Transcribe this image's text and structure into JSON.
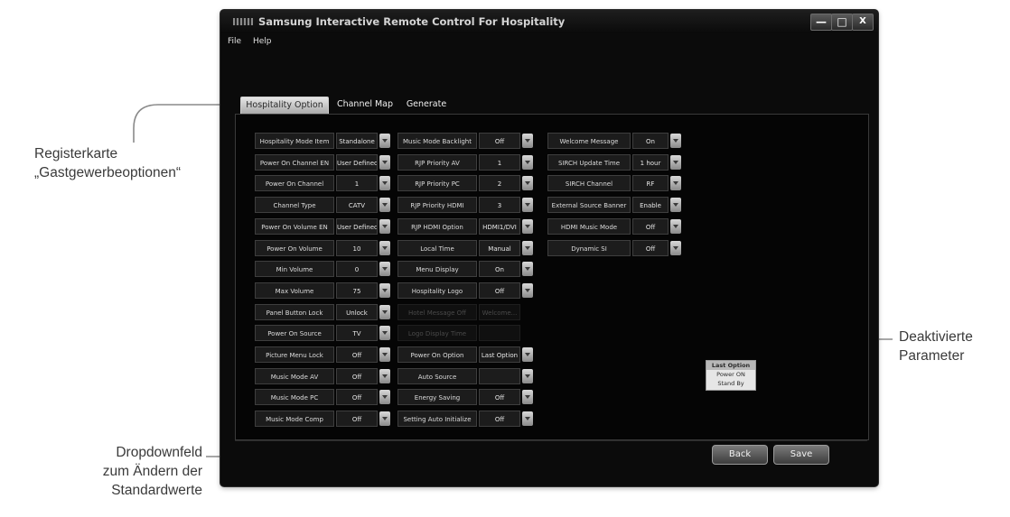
{
  "annotations": {
    "tab_callout": [
      "Registerkarte",
      "„Gastgewerbeoptionen“"
    ],
    "disabled_callout": [
      "Deaktivierte",
      "Parameter"
    ],
    "dropdown_callout": [
      "Dropdownfeld",
      "zum Ändern der",
      "Standardwerte"
    ]
  },
  "window": {
    "title": "Samsung Interactive Remote Control For Hospitality",
    "controls": {
      "minimize": "—",
      "maximize": "□",
      "close": "X"
    }
  },
  "menu": {
    "file": "File",
    "help": "Help"
  },
  "tabs": [
    {
      "label": "Hospitality Option",
      "active": true
    },
    {
      "label": "Channel Map",
      "active": false
    },
    {
      "label": "Generate",
      "active": false
    }
  ],
  "columns": [
    {
      "settings": [
        {
          "label": "Hospitality Mode Item",
          "value": "Standalone"
        },
        {
          "label": "Power On Channel EN",
          "value": "User Defined"
        },
        {
          "label": "Power On Channel",
          "value": "1"
        },
        {
          "label": "Channel Type",
          "value": "CATV"
        },
        {
          "label": "Power On Volume EN",
          "value": "User Defined"
        },
        {
          "label": "Power On Volume",
          "value": "10"
        },
        {
          "label": "Min Volume",
          "value": "0"
        },
        {
          "label": "Max Volume",
          "value": "75"
        },
        {
          "label": "Panel Button Lock",
          "value": "Unlock"
        },
        {
          "label": "Power On Source",
          "value": "TV"
        },
        {
          "label": "Picture Menu Lock",
          "value": "Off"
        },
        {
          "label": "Music Mode AV",
          "value": "Off"
        },
        {
          "label": "Music Mode PC",
          "value": "Off"
        },
        {
          "label": "Music Mode Comp",
          "value": "Off"
        }
      ]
    },
    {
      "settings": [
        {
          "label": "Music Mode Backlight",
          "value": "Off"
        },
        {
          "label": "RJP Priority AV",
          "value": "1"
        },
        {
          "label": "RJP Priority PC",
          "value": "2"
        },
        {
          "label": "RJP Priority HDMI",
          "value": "3"
        },
        {
          "label": "RJP HDMI Option",
          "value": "HDMI1/DVI"
        },
        {
          "label": "Local Time",
          "value": "Manual"
        },
        {
          "label": "Menu Display",
          "value": "On"
        },
        {
          "label": "Hospitality Logo",
          "value": "Off"
        },
        {
          "label": "Hotel Message Off",
          "value": "Welcome...",
          "disabled": true
        },
        {
          "label": "Logo Display Time",
          "value": "",
          "disabled": true
        },
        {
          "label": "Power On Option",
          "value": "Last Option"
        },
        {
          "label": "Auto Source",
          "value": ""
        },
        {
          "label": "Energy Saving",
          "value": "Off"
        },
        {
          "label": "Setting Auto Initialize",
          "value": "Off"
        }
      ]
    },
    {
      "settings": [
        {
          "label": "Welcome Message",
          "value": "On"
        },
        {
          "label": "SIRCH Update Time",
          "value": "1 hour"
        },
        {
          "label": "SIRCH Channel",
          "value": "RF"
        },
        {
          "label": "External Source Banner",
          "value": "Enable"
        },
        {
          "label": "HDMI Music Mode",
          "value": "Off"
        },
        {
          "label": "Dynamic SI",
          "value": "Off"
        }
      ]
    }
  ],
  "dropdown_options": [
    "Last Option",
    "Power ON",
    "Stand By"
  ],
  "buttons": {
    "back": "Back",
    "save": "Save"
  }
}
